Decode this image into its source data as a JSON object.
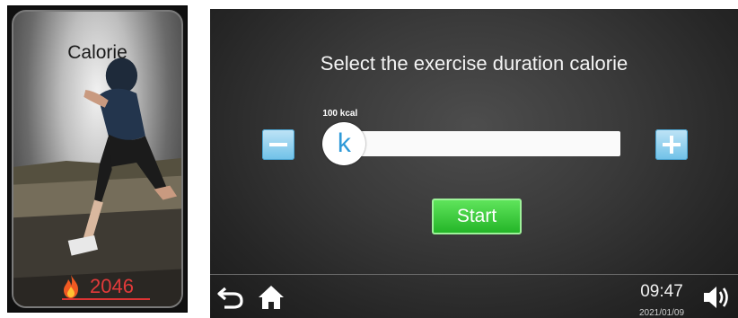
{
  "card": {
    "title": "Calorie",
    "value": "2046",
    "icon": "flame-icon"
  },
  "main": {
    "heading": "Select the exercise duration calorie",
    "slider": {
      "label": "100 kcal",
      "thumb_text": "k",
      "level_fraction": 0.02
    },
    "start_label": "Start",
    "minus_icon": "minus-icon",
    "plus_icon": "plus-icon"
  },
  "footer": {
    "time": "09:47",
    "date": "2021/01/09",
    "icons": [
      "back-icon",
      "home-icon",
      "volume-icon"
    ]
  },
  "colors": {
    "accent_blue": "#2f9ad8",
    "start_green": "#3fcb3c",
    "calorie_red": "#e23a3a"
  }
}
